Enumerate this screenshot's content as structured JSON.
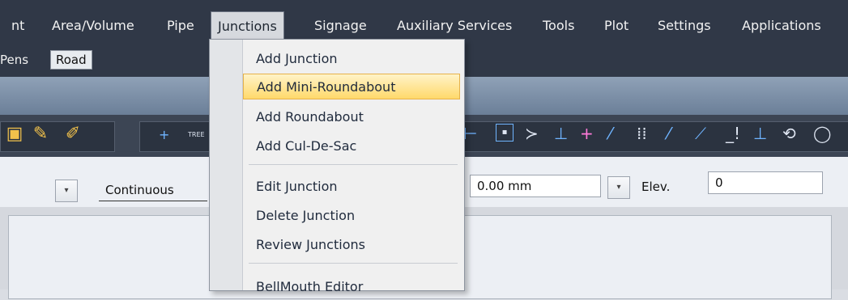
{
  "menubar": {
    "items": [
      "nt",
      "Area/Volume",
      "Pipe",
      "Junctions",
      "Signage",
      "Auxiliary Services",
      "Tools",
      "Plot",
      "Settings",
      "Applications"
    ],
    "active": "Junctions"
  },
  "tabs": {
    "pens": "Pens",
    "road": "Road"
  },
  "toolbar": {
    "tree_label": "TREE",
    "plus": "+"
  },
  "props": {
    "linetype": "Continuous",
    "width": "0.00 mm",
    "elev_label": "Elev.",
    "elev_value": "0"
  },
  "junctions_menu": {
    "items": [
      "Add Junction",
      "Add Mini-Roundabout",
      "Add Roundabout",
      "Add Cul-De-Sac",
      "Edit Junction",
      "Delete Junction",
      "Review Junctions",
      "BellMouth Editor"
    ],
    "highlighted": "Add Mini-Roundabout"
  },
  "colors": {
    "menubar_bg": "#303847",
    "highlight": "#ffd96b"
  }
}
